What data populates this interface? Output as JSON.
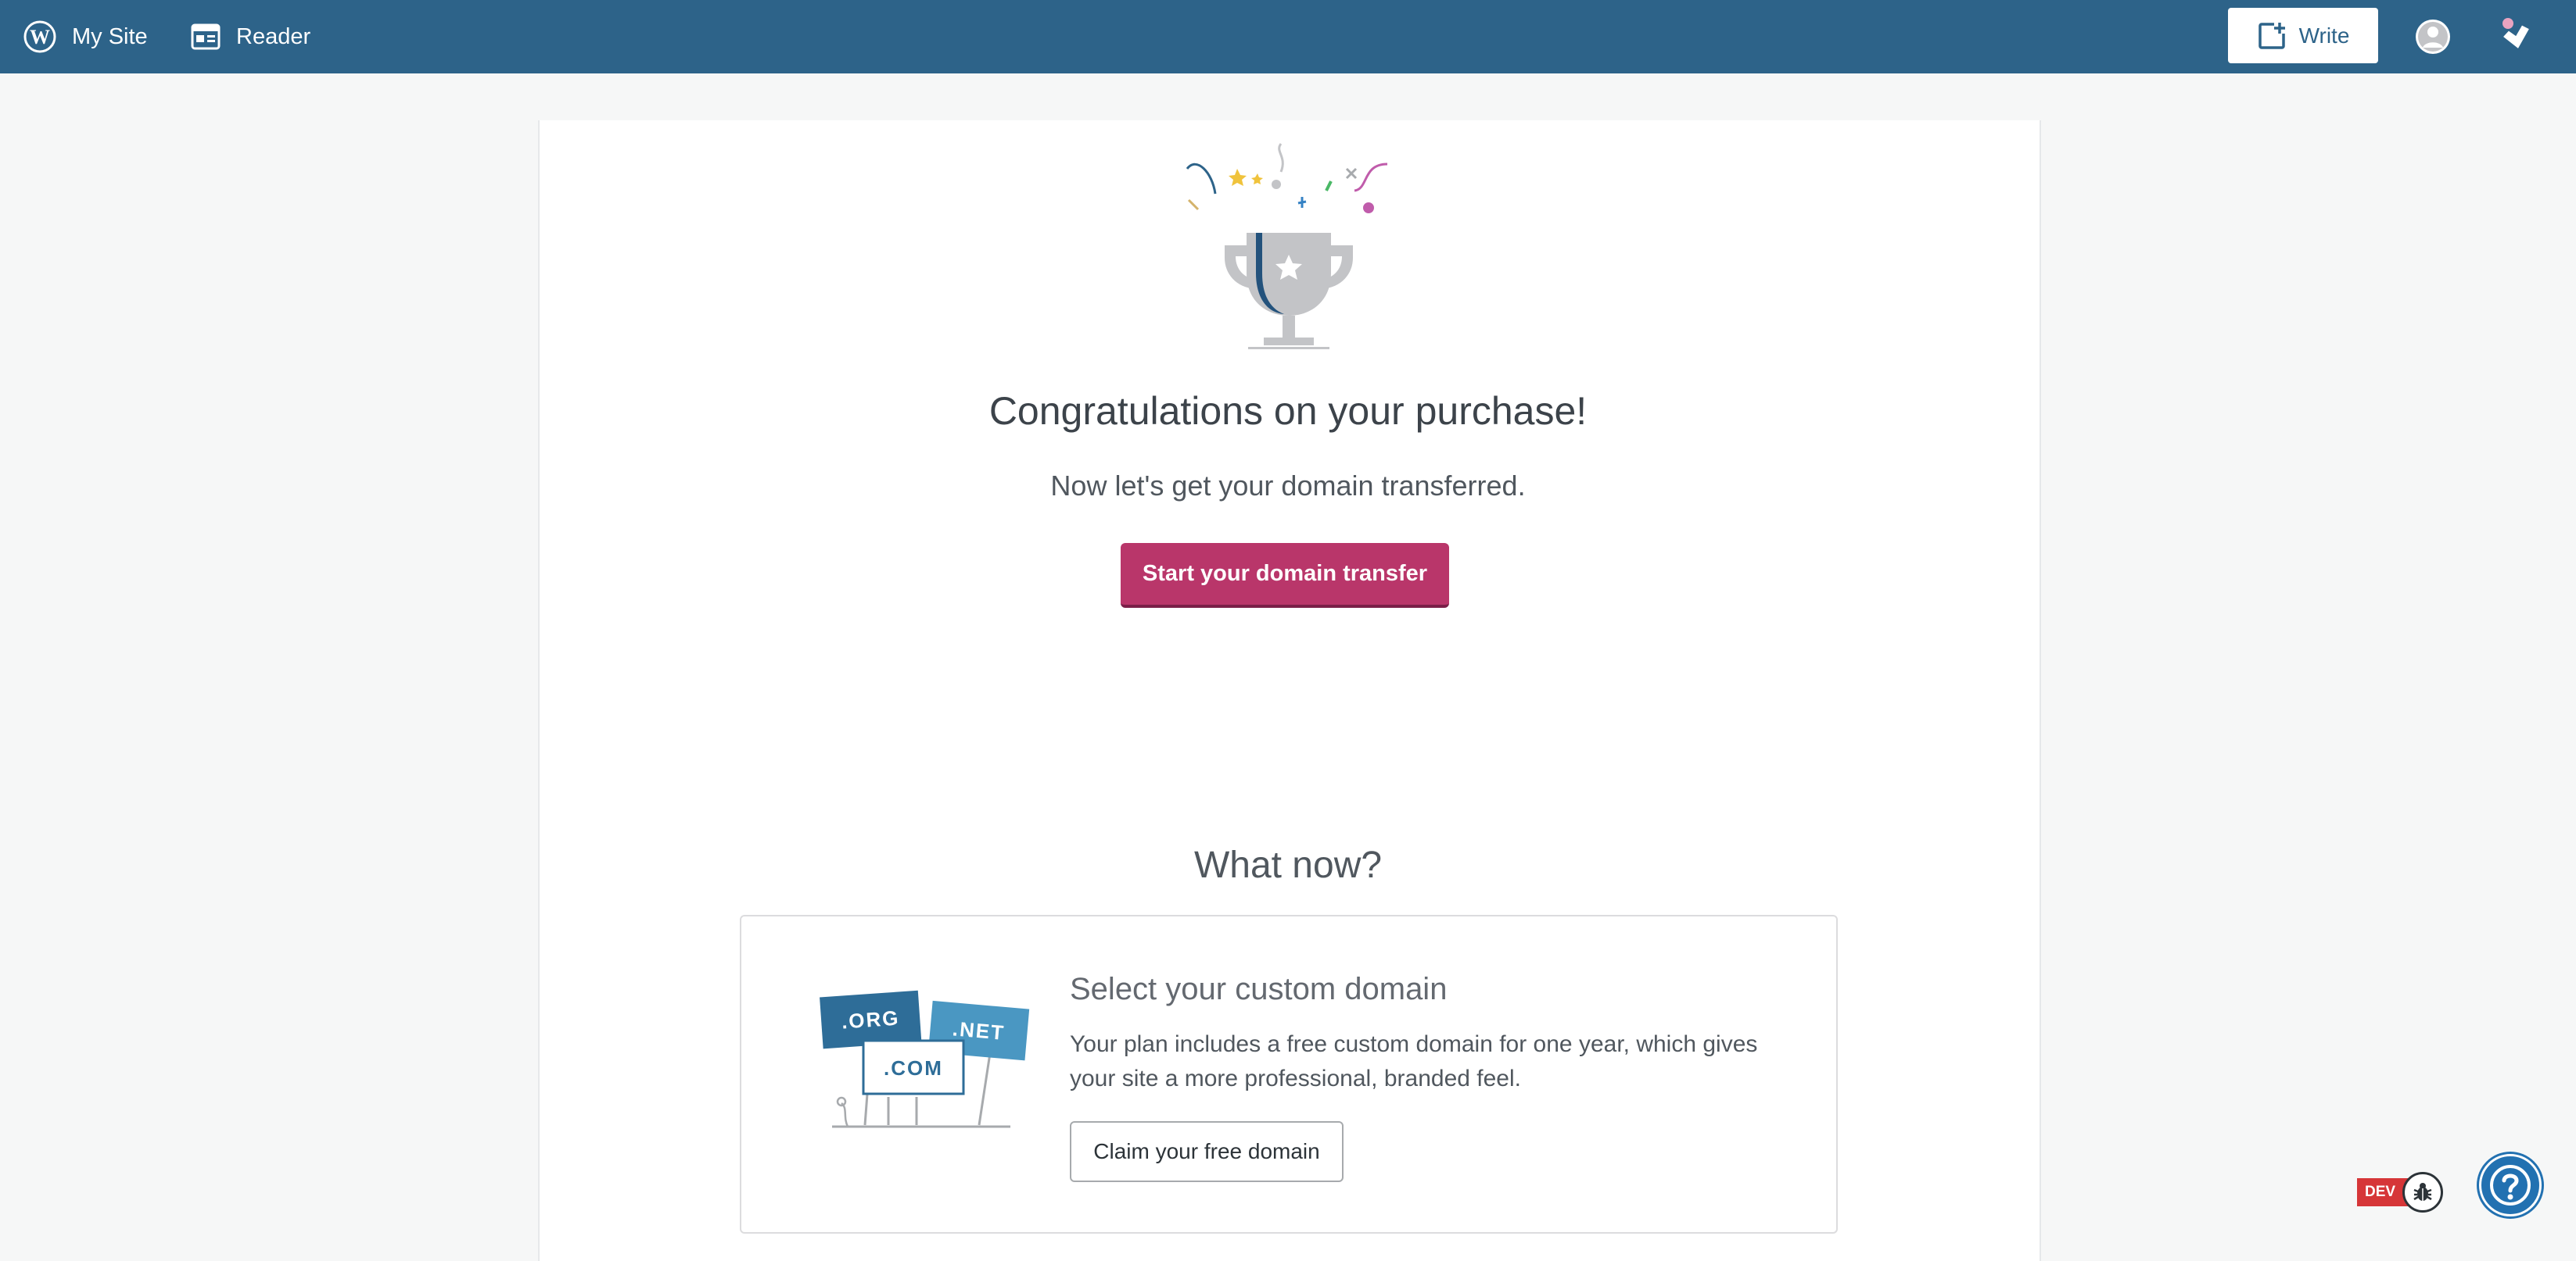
{
  "masterbar": {
    "my_site_label": "My Site",
    "reader_label": "Reader",
    "write_label": "Write"
  },
  "main": {
    "title": "Congratulations on your purchase!",
    "subtitle": "Now let's get your domain transferred.",
    "primary_button": "Start your domain transfer",
    "whatnow_heading": "What now?",
    "feature": {
      "title": "Select your custom domain",
      "description": "Your plan includes a free custom domain for one year, which gives your site a more professional, branded feel.",
      "button_label": "Claim your free domain",
      "illustration_signs": [
        ".ORG",
        ".NET",
        ".COM"
      ]
    }
  },
  "dev_badge": "DEV",
  "colors": {
    "masterbar": "#2d6389",
    "primary_button": "#b9366a",
    "help_button": "#2271b1",
    "dev_badge": "#d63638"
  },
  "icons": {
    "my_site": "wordpress-logo-icon",
    "reader": "reader-icon",
    "write": "write-plus-icon",
    "avatar": "avatar-icon",
    "notifications": "notifications-bell-icon",
    "bug": "bug-icon",
    "help": "help-question-icon"
  }
}
